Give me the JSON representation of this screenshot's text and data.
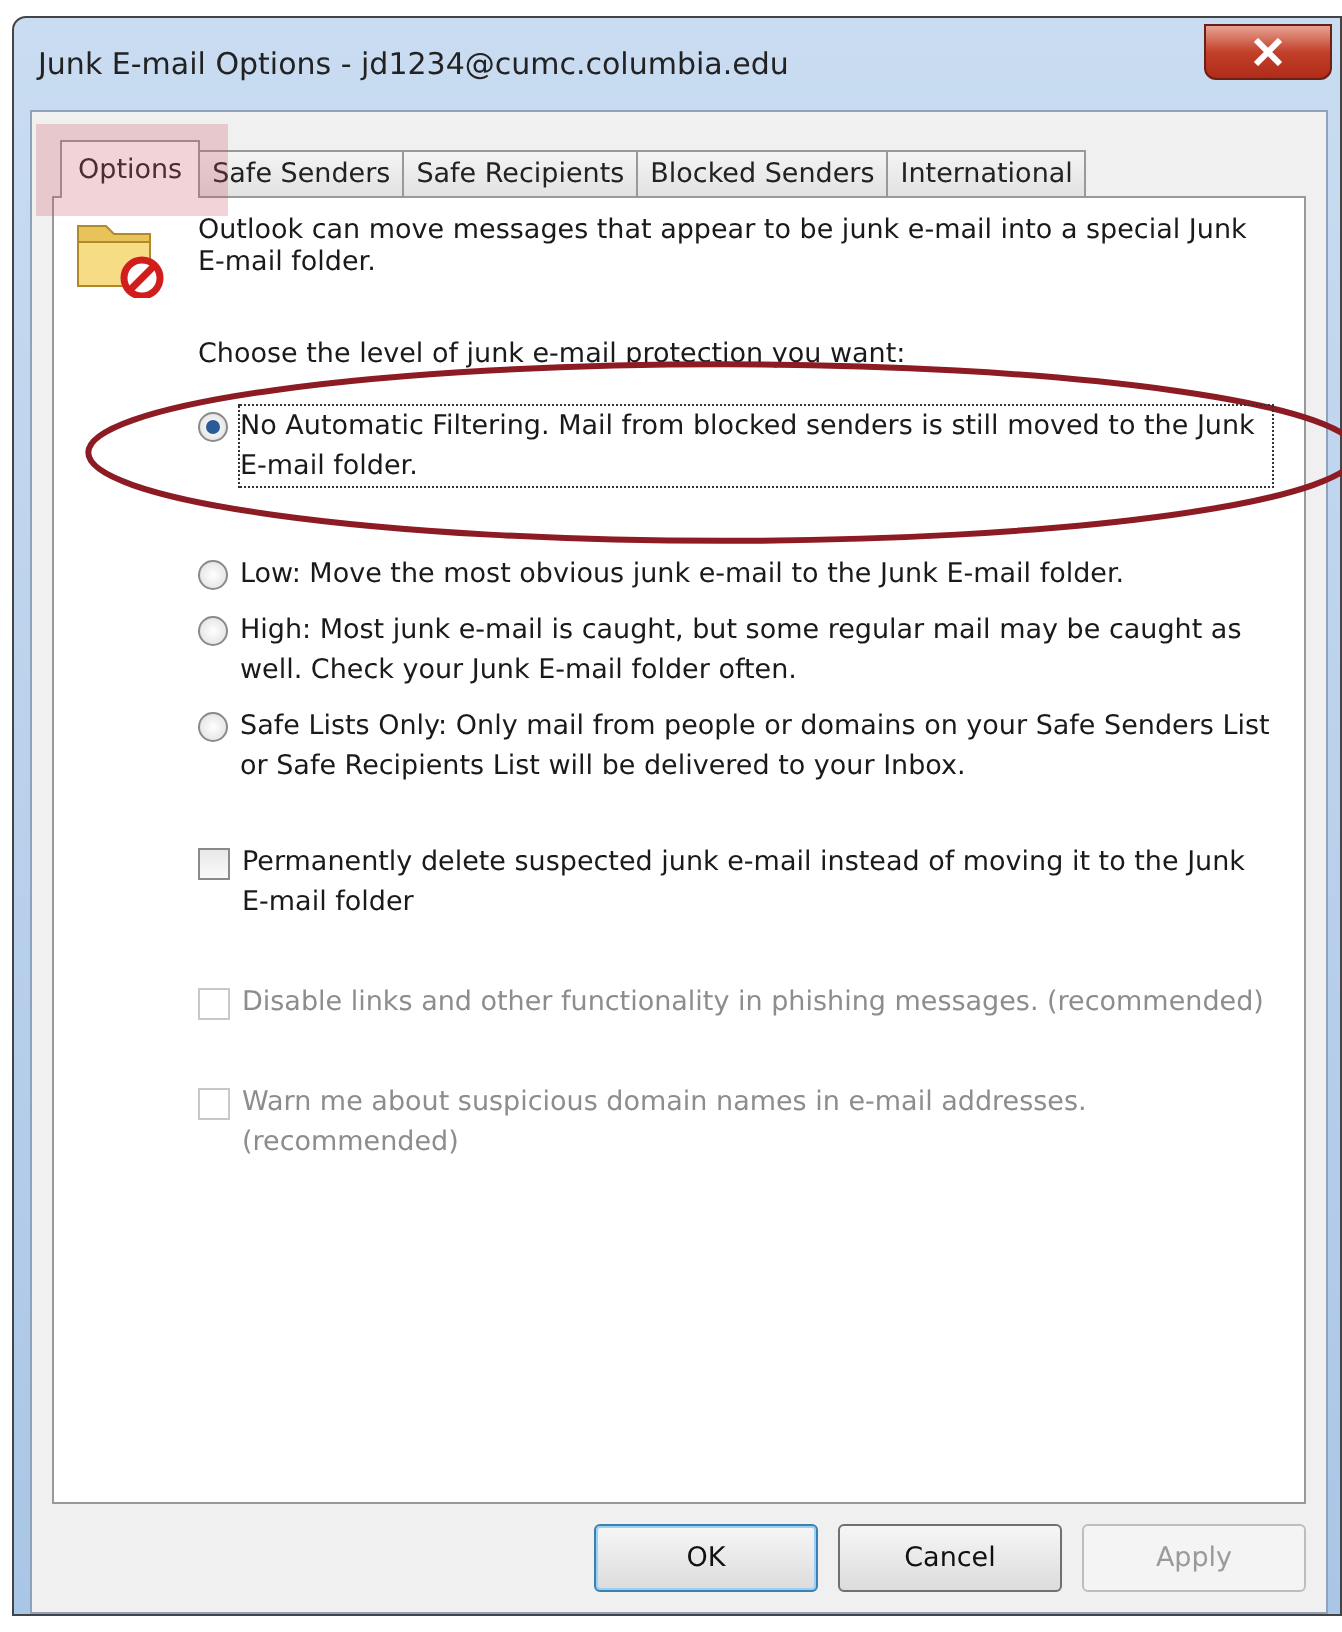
{
  "window": {
    "title": "Junk E-mail Options - jd1234@cumc.columbia.edu"
  },
  "tabs": [
    {
      "label": "Options",
      "selected": true
    },
    {
      "label": "Safe Senders",
      "selected": false
    },
    {
      "label": "Safe Recipients",
      "selected": false
    },
    {
      "label": "Blocked Senders",
      "selected": false
    },
    {
      "label": "International",
      "selected": false
    }
  ],
  "intro": "Outlook can move messages that appear to be junk e-mail into a special Junk E-mail folder.",
  "prompt": "Choose the level of junk e-mail protection you want:",
  "levels": [
    {
      "label": "No Automatic Filtering. Mail from blocked senders is still moved to the Junk E-mail folder.",
      "selected": true
    },
    {
      "label": "Low: Move the most obvious junk e-mail to the Junk E-mail folder.",
      "selected": false
    },
    {
      "label": "High: Most junk e-mail is caught, but some regular mail may be caught as well. Check your Junk E-mail folder often.",
      "selected": false
    },
    {
      "label": "Safe Lists Only: Only mail from people or domains on your Safe Senders List or Safe Recipients List will be delivered to your Inbox.",
      "selected": false
    }
  ],
  "options": [
    {
      "label": "Permanently delete suspected junk e-mail instead of moving it to the Junk E-mail folder",
      "checked": false,
      "disabled": false
    },
    {
      "label": "Disable links and other functionality in phishing messages. (recommended)",
      "checked": false,
      "disabled": true
    },
    {
      "label": "Warn me about suspicious domain names in e-mail addresses. (recommended)",
      "checked": false,
      "disabled": true
    }
  ],
  "buttons": [
    {
      "label": "OK",
      "disabled": false,
      "default": true
    },
    {
      "label": "Cancel",
      "disabled": false,
      "default": false
    },
    {
      "label": "Apply",
      "disabled": true,
      "default": false
    }
  ]
}
